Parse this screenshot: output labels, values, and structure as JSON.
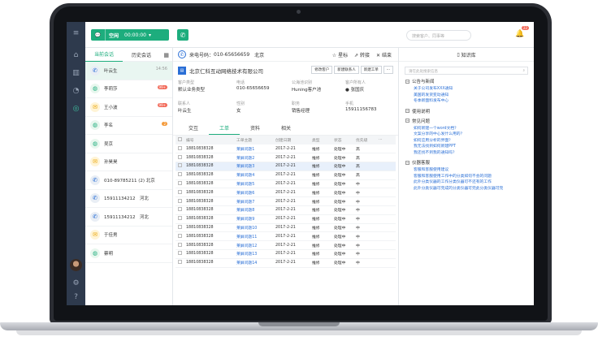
{
  "topbar": {
    "status": "空闲",
    "timer": "00:00:00",
    "search_placeholder": "搜索客户、同事等",
    "notification_count": "22"
  },
  "conversations": {
    "tab_current": "当前会话",
    "tab_history": "历史会话",
    "items": [
      {
        "name": "叶云生",
        "time": "14:56",
        "badge": "",
        "icon": "phone-icon"
      },
      {
        "name": "李莉莎",
        "time": "",
        "badge": "99+",
        "icon": "wechat-icon"
      },
      {
        "name": "王小波",
        "time": "",
        "badge": "99+",
        "icon": "message-icon"
      },
      {
        "name": "李名",
        "time": "",
        "badge": "2",
        "icon": "wechat-icon"
      },
      {
        "name": "吴京",
        "time": "",
        "badge": "",
        "icon": "wechat-icon"
      },
      {
        "name": "孙昊昊",
        "time": "",
        "badge": "",
        "icon": "message-icon"
      },
      {
        "name": "010-89785211 (2) 北京",
        "time": "",
        "badge": "",
        "icon": "phone-icon"
      },
      {
        "name": "15911134212　河北",
        "time": "",
        "badge": "",
        "icon": "phone-icon"
      },
      {
        "name": "15911134212　河北",
        "time": "",
        "badge": "",
        "icon": "phone-icon"
      },
      {
        "name": "于佳男",
        "time": "",
        "badge": "",
        "icon": "message-icon"
      },
      {
        "name": "蔡明",
        "time": "",
        "badge": "",
        "icon": "wechat-icon"
      }
    ]
  },
  "call": {
    "label": "来电号码：",
    "number": "010-65656659",
    "city": "北京",
    "actions": [
      "星标",
      "转接",
      "结束"
    ]
  },
  "company": {
    "name": "北京仁科互动网络技术有限公司",
    "buttons": [
      "修改客户",
      "新建联系人",
      "新建工单",
      "···"
    ]
  },
  "fields": [
    {
      "label": "客户类型",
      "value": "默认业务类型"
    },
    {
      "label": "电话",
      "value": "010-65656659"
    },
    {
      "label": "公海池识别",
      "value": "Huning客户池"
    },
    {
      "label": "客户所有人",
      "value": "张国庆"
    },
    {
      "label": "联系人",
      "value": "叶云生"
    },
    {
      "label": "性别",
      "value": "女"
    },
    {
      "label": "职务",
      "value": "销售经理"
    },
    {
      "label": "手机",
      "value": "15911156783"
    }
  ],
  "detail_tabs": [
    "交互",
    "工单",
    "资料",
    "相关"
  ],
  "ticket_table": {
    "headers": [
      "编号",
      "工单主题",
      "创建日期",
      "类型",
      "状态",
      "优先级",
      "···"
    ],
    "rows": [
      [
        "18810838328",
        "莱屏问题1",
        "2017-2-21",
        "推修",
        "处理中",
        "高"
      ],
      [
        "18810838328",
        "莱屏问题2",
        "2017-2-21",
        "推修",
        "处理中",
        "高"
      ],
      [
        "18810838328",
        "莱屏问题3",
        "2017-2-21",
        "推修",
        "处理中",
        "高"
      ],
      [
        "18810838328",
        "莱屏问题4",
        "2017-2-21",
        "推修",
        "处理中",
        "高"
      ],
      [
        "18810838328",
        "莱屏问题5",
        "2017-2-21",
        "推修",
        "处理中",
        "中"
      ],
      [
        "18810838328",
        "莱屏问题6",
        "2017-2-21",
        "推修",
        "处理中",
        "中"
      ],
      [
        "18810838328",
        "莱屏问题7",
        "2017-2-21",
        "推修",
        "处理中",
        "中"
      ],
      [
        "18810838328",
        "莱屏问题8",
        "2017-2-21",
        "推修",
        "处理中",
        "中"
      ],
      [
        "18810838328",
        "莱屏问题9",
        "2017-2-21",
        "推修",
        "处理中",
        "中"
      ],
      [
        "18810838328",
        "莱屏问题10",
        "2017-2-21",
        "推修",
        "处理中",
        "中"
      ],
      [
        "18810838328",
        "莱屏问题11",
        "2017-2-21",
        "推修",
        "处理中",
        "中"
      ],
      [
        "18810838328",
        "莱屏问题12",
        "2017-2-21",
        "推修",
        "处理中",
        "中"
      ],
      [
        "18810838328",
        "莱屏问题13",
        "2017-2-21",
        "推修",
        "处理中",
        "中"
      ],
      [
        "18810838328",
        "莱屏问题14",
        "2017-2-21",
        "推修",
        "处理中",
        "中"
      ]
    ]
  },
  "kb": {
    "title": "知识库",
    "search_placeholder": "请在此处搜索信息",
    "sections": [
      {
        "title": "公告与新闻",
        "links": [
          "关于公司发布XXX通知",
          "美国的发货变动通知",
          "冬季新面料发布中心"
        ]
      },
      {
        "title": "使用说明",
        "links": []
      },
      {
        "title": "常见问题",
        "links": [
          "如何新建一个word文档？",
          "文案分享的中心发什么用的？",
          "如何应用分析的界面？",
          "我无法找到如何新建PPT",
          "我还找不到我的通知吗？"
        ]
      },
      {
        "title": "仪器客服",
        "links": [
          "客服和客服使用建议",
          "客服和客服使用工作中的分类如何不会的问题",
          "此外分类仪器的工作分类仪器可不还有的工作",
          "此外分类仪器可完成的分类仪器可完此分类仪器可完"
        ]
      }
    ]
  }
}
